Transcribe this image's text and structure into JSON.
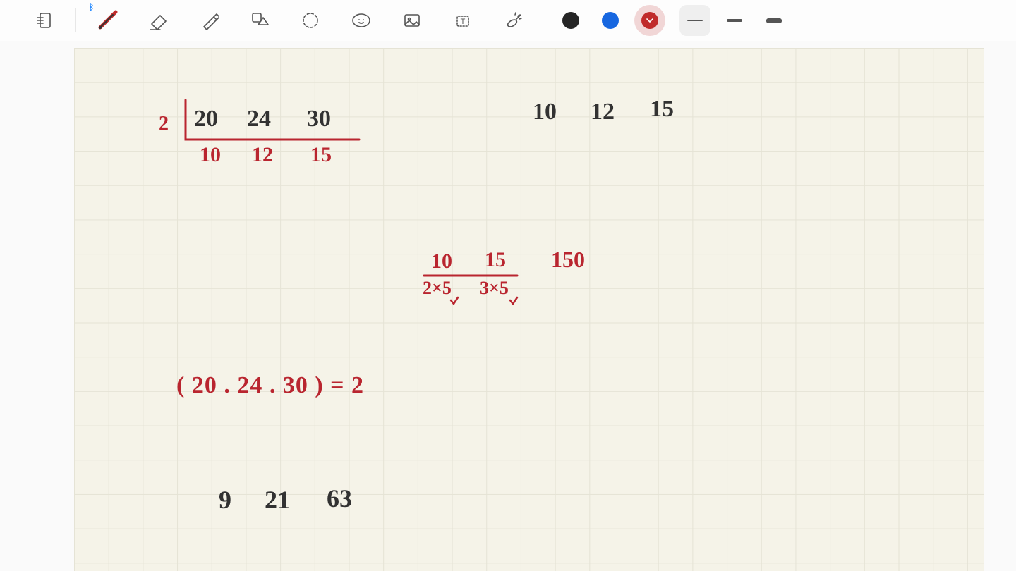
{
  "toolbar": {
    "tools": [
      "page-settings",
      "pen",
      "eraser",
      "highlighter",
      "shape",
      "lasso",
      "sticker",
      "image",
      "text",
      "laser"
    ],
    "colors": {
      "black": "#252525",
      "blue": "#1767e0",
      "red": "#c02a2a",
      "selected": "red"
    },
    "thickness": {
      "options": [
        "thin",
        "medium",
        "thick"
      ],
      "selected": "thin"
    }
  },
  "handwriting": {
    "division": {
      "divisor": "2",
      "row1": [
        "20",
        "24",
        "30"
      ],
      "row2": [
        "10",
        "12",
        "15"
      ]
    },
    "topright": [
      "10",
      "12",
      "15"
    ],
    "factor": {
      "top": [
        "10",
        "15"
      ],
      "bottom": [
        "2×5",
        "3×5"
      ],
      "result": "150"
    },
    "gcd_text": "( 20 . 24 . 30 ) = 2",
    "bottom_row": [
      "9",
      "21",
      "63"
    ]
  }
}
